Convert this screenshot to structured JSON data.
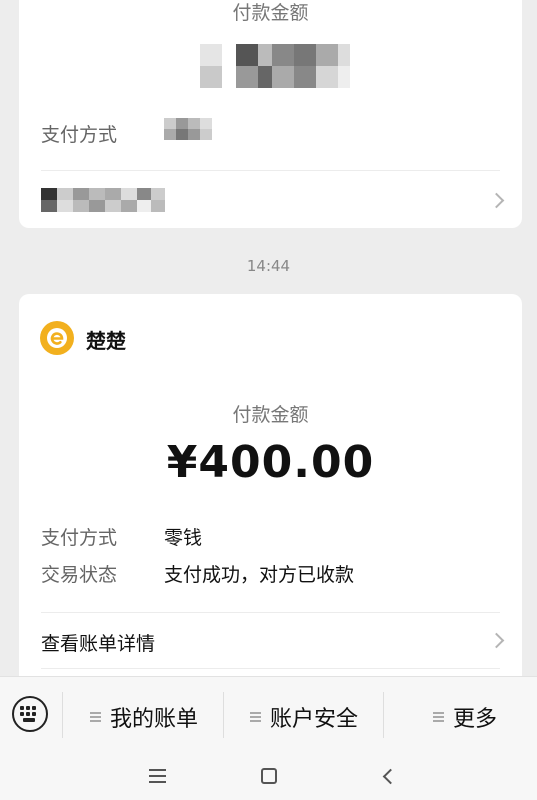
{
  "top_card": {
    "amount_label": "付款金额",
    "payment_method_label": "支付方式",
    "link_label": "查看账单详情"
  },
  "timestamp": "14:44",
  "main_card": {
    "merchant_name": "楚楚",
    "amount_label": "付款金额",
    "amount": "¥400.00",
    "payment_method_label": "支付方式",
    "payment_method_value": "零钱",
    "status_label": "交易状态",
    "status_value": "支付成功，对方已收款",
    "details_link": "查看账单详情"
  },
  "bottom_menu": {
    "items": [
      {
        "label": "我的账单",
        "icon": "menu-lines-icon"
      },
      {
        "label": "账户安全",
        "icon": "menu-lines-icon"
      },
      {
        "label": "更多",
        "icon": "menu-lines-icon"
      }
    ],
    "keyboard_icon": "keyboard-icon"
  },
  "colors": {
    "background": "#ededed",
    "card": "#ffffff",
    "merchant_icon": "#f2b01e"
  }
}
